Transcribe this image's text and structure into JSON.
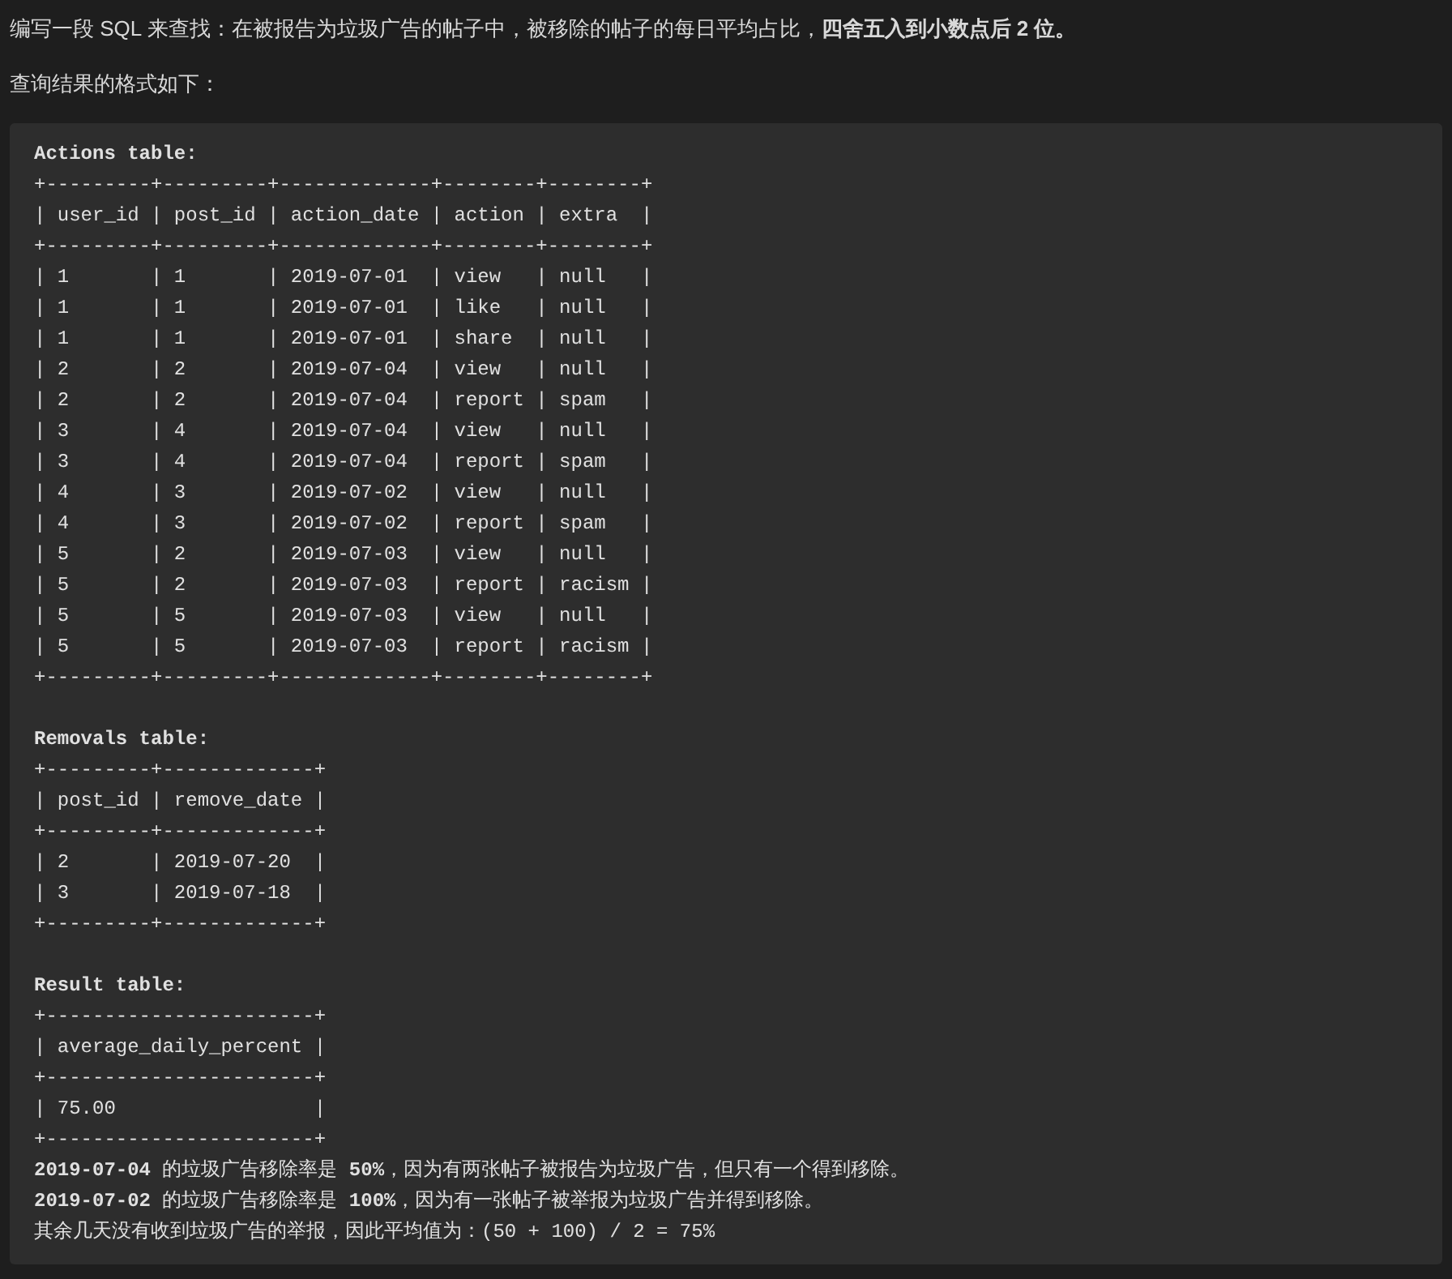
{
  "intro": [
    "编写一段 SQL 来查找：在被报告为垃圾广告的帖子中，被移除的帖子的每日平均占比，**四舍五入到小数点后 2 位。**",
    "查询结果的格式如下："
  ],
  "tables": [
    {
      "title": "Actions table:",
      "lines": [
        "+---------+---------+-------------+--------+--------+",
        "| user_id | post_id | action_date | action | extra  |",
        "+---------+---------+-------------+--------+--------+",
        "| 1       | 1       | 2019-07-01  | view   | null   |",
        "| 1       | 1       | 2019-07-01  | like   | null   |",
        "| 1       | 1       | 2019-07-01  | share  | null   |",
        "| 2       | 2       | 2019-07-04  | view   | null   |",
        "| 2       | 2       | 2019-07-04  | report | spam   |",
        "| 3       | 4       | 2019-07-04  | view   | null   |",
        "| 3       | 4       | 2019-07-04  | report | spam   |",
        "| 4       | 3       | 2019-07-02  | view   | null   |",
        "| 4       | 3       | 2019-07-02  | report | spam   |",
        "| 5       | 2       | 2019-07-03  | view   | null   |",
        "| 5       | 2       | 2019-07-03  | report | racism |",
        "| 5       | 5       | 2019-07-03  | view   | null   |",
        "| 5       | 5       | 2019-07-03  | report | racism |",
        "+---------+---------+-------------+--------+--------+"
      ]
    },
    {
      "title": "Removals table:",
      "lines": [
        "+---------+-------------+",
        "| post_id | remove_date |",
        "+---------+-------------+",
        "| 2       | 2019-07-20  |",
        "| 3       | 2019-07-18  |",
        "+---------+-------------+"
      ]
    },
    {
      "title": "Result table:",
      "lines": [
        "+-----------------------+",
        "| average_daily_percent |",
        "+-----------------------+",
        "| 75.00                 |",
        "+-----------------------+"
      ]
    }
  ],
  "notes": [
    "**2019-07-04** 的垃圾广告移除率是 **50%**，因为有两张帖子被报告为垃圾广告，但只有一个得到移除。",
    "**2019-07-02** 的垃圾广告移除率是 **100%**，因为有一张帖子被举报为垃圾广告并得到移除。",
    "其余几天没有收到垃圾广告的举报，因此平均值为：(50 + 100) / 2 = 75%"
  ]
}
